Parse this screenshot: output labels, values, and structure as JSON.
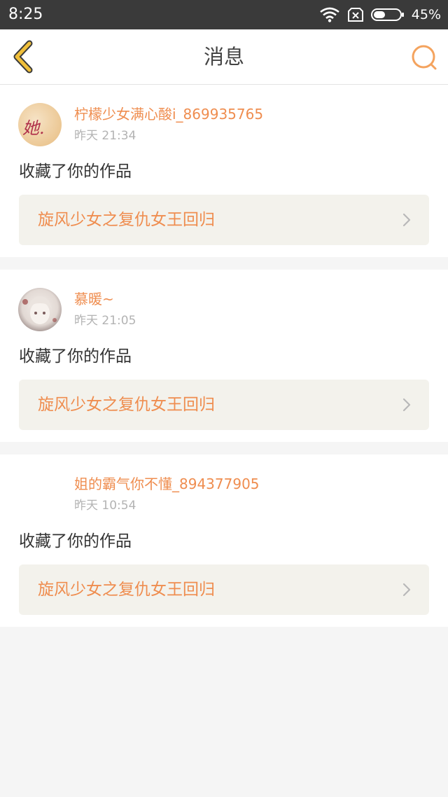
{
  "status_bar": {
    "time": "8:25",
    "battery_percent": "45%",
    "battery_level": 0.45,
    "icons": [
      "wifi-icon",
      "no-sim-icon",
      "battery-icon"
    ]
  },
  "nav": {
    "title": "消息",
    "back_icon": "chevron-left-icon",
    "search_icon": "search-icon"
  },
  "colors": {
    "accent": "#ef8d4f",
    "nav_icon": "#f0bf3a",
    "search_icon": "#f4a35e",
    "card_link_bg": "#f3f2ec",
    "page_bg": "#f5f5f5"
  },
  "messages": [
    {
      "username": "柠檬少女满心酸i_869935765",
      "time": "昨天 21:34",
      "action": "收藏了你的作品",
      "work_title": "旋风少女之复仇女王回归",
      "avatar_text": "她."
    },
    {
      "username": "慕暖~",
      "time": "昨天 21:05",
      "action": "收藏了你的作品",
      "work_title": "旋风少女之复仇女王回归"
    },
    {
      "username": "姐的霸气你不懂_894377905",
      "time": "昨天 10:54",
      "action": "收藏了你的作品",
      "work_title": "旋风少女之复仇女王回归"
    }
  ]
}
